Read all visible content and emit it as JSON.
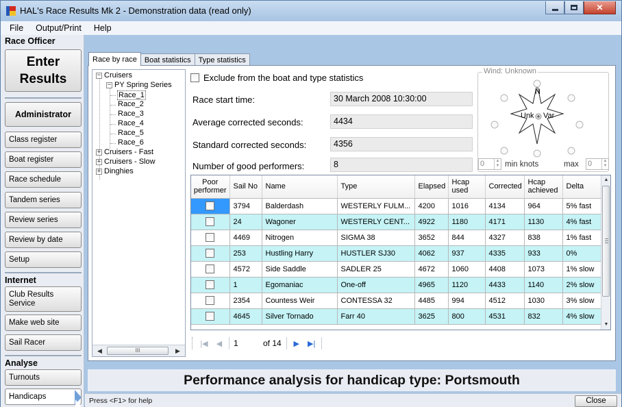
{
  "window": {
    "title": "HAL's Race Results Mk 2 - Demonstration data (read only)",
    "controls": [
      "minimize-icon",
      "maximize-icon",
      "close-icon"
    ],
    "close_glyph": "✕"
  },
  "menu": [
    "File",
    "Output/Print",
    "Help"
  ],
  "sidebar": {
    "race_officer_label": "Race Officer",
    "enter_results_line1": "Enter",
    "enter_results_line2": "Results",
    "administrator_label": "Administrator",
    "admin_items": [
      "Class register",
      "Boat register",
      "Race schedule",
      "Tandem series",
      "Review series",
      "Review by date",
      "Setup"
    ],
    "internet_label": "Internet",
    "internet_items": [
      "Club Results Service",
      "Make web site",
      "Sail Racer"
    ],
    "analyse_label": "Analyse",
    "analyse_items": [
      "Turnouts",
      "Handicaps"
    ]
  },
  "tabs": [
    "Race by race",
    "Boat statistics",
    "Type statistics"
  ],
  "tree": {
    "root": "Cruisers",
    "series": "PY Spring Series",
    "races": [
      "Race_1",
      "Race_2",
      "Race_3",
      "Race_4",
      "Race_5",
      "Race_6"
    ],
    "others": [
      "Cruisers - Fast",
      "Cruisers - Slow",
      "Dinghies"
    ],
    "scroll_thumb_glyph": "III"
  },
  "race": {
    "exclude_label": "Exclude from the boat and type statistics",
    "start_time_label": "Race start time:",
    "start_time": "30 March 2008 10:30:00",
    "avg_corrected_label": "Average corrected seconds:",
    "avg_corrected": "4434",
    "std_corrected_label": "Standard corrected seconds:",
    "std_corrected": "4356",
    "good_performers_label": "Number of good performers:",
    "good_performers": "8"
  },
  "wind": {
    "title": "Wind: Unknown",
    "north": "N",
    "unk": "Unk",
    "var": "Var",
    "min_value": "0",
    "min_label": "min knots",
    "max_label": "max",
    "max_value": "0"
  },
  "grid": {
    "headers": [
      "Poor performer",
      "Sail No",
      "Name",
      "Type",
      "Elapsed",
      "Hcap used",
      "Corrected",
      "Hcap achieved",
      "Delta"
    ],
    "rows": [
      [
        "3794",
        "Balderdash",
        "WESTERLY FULM...",
        "4200",
        "1016",
        "4134",
        "964",
        "5% fast"
      ],
      [
        "24",
        "Wagoner",
        "WESTERLY CENT...",
        "4922",
        "1180",
        "4171",
        "1130",
        "4% fast"
      ],
      [
        "4469",
        "Nitrogen",
        "SIGMA 38",
        "3652",
        "844",
        "4327",
        "838",
        "1% fast"
      ],
      [
        "253",
        "Hustling Harry",
        "HUSTLER SJ30",
        "4062",
        "937",
        "4335",
        "933",
        "0%"
      ],
      [
        "4572",
        "Side Saddle",
        "SADLER 25",
        "4672",
        "1060",
        "4408",
        "1073",
        "1% slow"
      ],
      [
        "1",
        "Egomaniac",
        "One-off",
        "4965",
        "1120",
        "4433",
        "1140",
        "2% slow"
      ],
      [
        "2354",
        "Countess Weir",
        "CONTESSA 32",
        "4485",
        "994",
        "4512",
        "1030",
        "3% slow"
      ],
      [
        "4645",
        "Silver Tornado",
        "Farr 40",
        "3625",
        "800",
        "4531",
        "832",
        "4% slow"
      ]
    ],
    "row_highlight_color": "#c5f3f6",
    "selected_cell_color": "#3399ff"
  },
  "pager": {
    "current_page": "1",
    "of_pages": "of 14"
  },
  "performance_title": "Performance analysis for handicap type: Portsmouth",
  "status": {
    "help_text": "Press <F1> for help",
    "close_label": "Close"
  }
}
